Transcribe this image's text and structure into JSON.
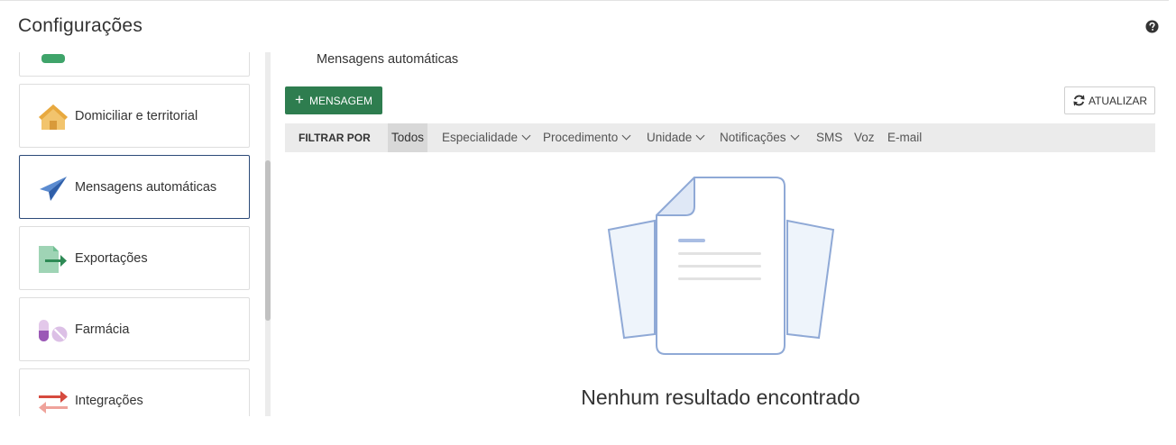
{
  "page": {
    "title": "Configurações"
  },
  "sidebar": {
    "items": [
      {
        "label": "",
        "icon": "green-badge-icon"
      },
      {
        "label": "Domiciliar e territorial",
        "icon": "house-icon"
      },
      {
        "label": "Mensagens automáticas",
        "icon": "paper-plane-icon",
        "active": true
      },
      {
        "label": "Exportações",
        "icon": "export-file-icon"
      },
      {
        "label": "Farmácia",
        "icon": "pills-icon"
      },
      {
        "label": "Integrações",
        "icon": "arrows-exchange-icon"
      }
    ]
  },
  "main": {
    "section_title": "Mensagens automáticas",
    "add_button": "MENSAGEM",
    "refresh_button": "ATUALIZAR",
    "filter": {
      "label": "FILTRAR POR",
      "options": [
        {
          "label": "Todos",
          "selected": true
        },
        {
          "label": "Especialidade",
          "dropdown": true
        },
        {
          "label": "Procedimento",
          "dropdown": true
        },
        {
          "label": "Unidade",
          "dropdown": true
        },
        {
          "label": "Notificações",
          "dropdown": true
        },
        {
          "label": "SMS"
        },
        {
          "label": "Voz"
        },
        {
          "label": "E-mail"
        }
      ]
    },
    "empty_message": "Nenhum resultado encontrado"
  },
  "colors": {
    "primary_green": "#2e7d4f",
    "active_border": "#2c4a78",
    "filter_bg": "#ebebeb"
  }
}
